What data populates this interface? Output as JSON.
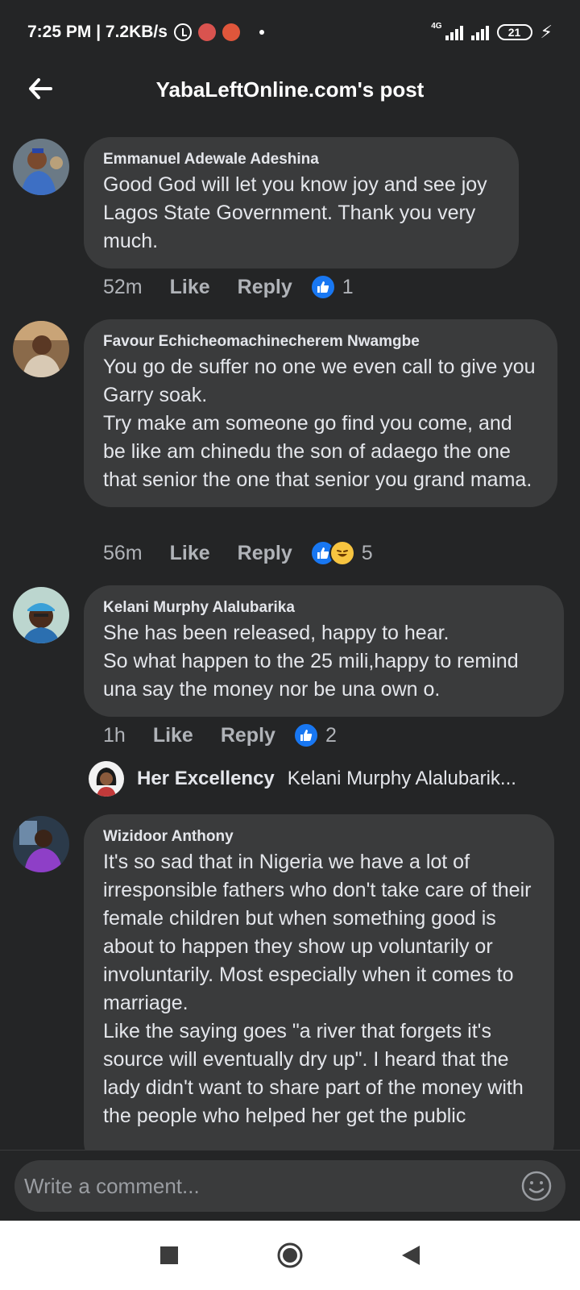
{
  "status_bar": {
    "time_speed": "7:25 PM | 7.2KB/s",
    "network": "4G",
    "battery": "21"
  },
  "header": {
    "title": "YabaLeftOnline.com's post"
  },
  "comments": [
    {
      "author": "Emmanuel Adewale Adeshina",
      "text": "Good God will let you know joy and see joy Lagos State Government. Thank you very much.",
      "time": "52m",
      "like_label": "Like",
      "reply_label": "Reply",
      "reaction_count": "1"
    },
    {
      "author": "Favour Echicheomachinecherem Nwamgbe",
      "text": "You go de suffer no one we even call to give you Garry soak.\nTry make am someone go find you come, and be like am chinedu the son of adaego the one that senior the one that senior you grand mama.",
      "time": "56m",
      "like_label": "Like",
      "reply_label": "Reply",
      "reaction_count": "5"
    },
    {
      "author": "Kelani Murphy Alalubarika",
      "text": "She has been released, happy to hear.\nSo what happen to the 25 mili,happy to remind una say the money nor be una own o.",
      "time": "1h",
      "like_label": "Like",
      "reply_label": "Reply",
      "reaction_count": "2",
      "reply_preview": {
        "name": "Her Excellency",
        "text": "Kelani Murphy Alalubarik..."
      }
    },
    {
      "author": "Wizidoor Anthony",
      "text": "It's so sad that in Nigeria we have a lot of irresponsible fathers who don't take care of their female children but when something good is about to happen they show up voluntarily or involuntarily. Most especially when it comes to marriage.\nLike the saying goes \"a river that forgets it's source will eventually dry up\". I heard that the lady didn't want to share part of the money with the people who helped her get the public"
    }
  ],
  "composer": {
    "placeholder": "Write a comment..."
  },
  "colors": {
    "background": "#242526",
    "bubble": "#3a3b3c",
    "like_blue": "#1877f2"
  }
}
